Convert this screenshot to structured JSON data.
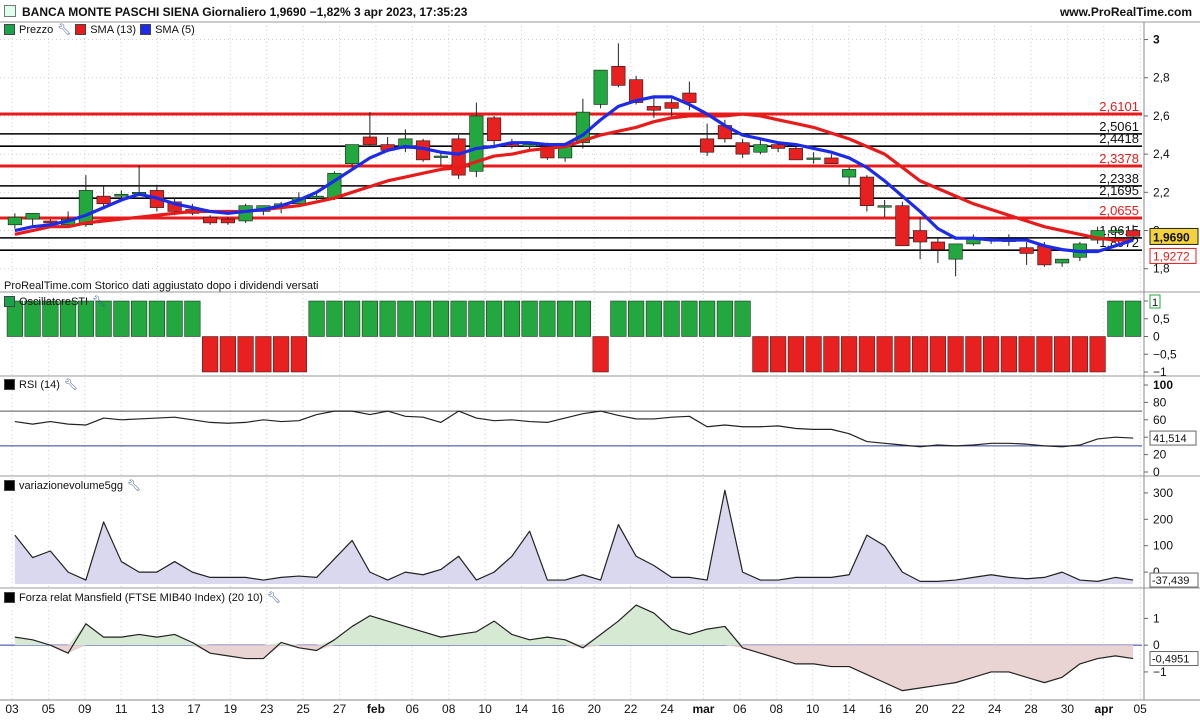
{
  "header": {
    "title": "BANCA MONTE PASCHI SIENA Giornaliero 1,9690 −1,82% 3 apr 2023, 17:35:23",
    "site": "www.ProRealTime.com"
  },
  "panels": {
    "price": {
      "legend": [
        {
          "label": "Prezzo",
          "color": "#19a34a"
        },
        {
          "label": "SMA (13)",
          "color": "#e81b1b"
        },
        {
          "label": "SMA (5)",
          "color": "#1b2be8"
        }
      ],
      "note": "ProRealTime.com Storico dati aggiustato dopo i dividendi versati"
    },
    "sti": {
      "legend": "OscillatoreSTI"
    },
    "rsi": {
      "legend": "RSI (14)"
    },
    "vol": {
      "legend": "variazionevolume5gg"
    },
    "mansfield": {
      "legend": "Forza relat Mansfield (FTSE MIB40 Index) (20 10)"
    }
  },
  "colors": {
    "up": "#22a83f",
    "down": "#e8201f",
    "sma13": "#e81b1b",
    "sma5": "#1b2be8",
    "grid": "#cfcfcf",
    "level_red": "#e81b1b",
    "level_black": "#000000"
  },
  "chart_data": [
    {
      "type": "candlestick",
      "title": "Prezzo",
      "ylim": [
        1.72,
        3.05
      ],
      "y_ticks": [
        "1,8",
        "2",
        "2,2",
        "2,4",
        "2,6",
        "2,8",
        "3"
      ],
      "x_ticks": [
        "03",
        "05",
        "09",
        "11",
        "13",
        "17",
        "19",
        "23",
        "25",
        "27",
        "feb",
        "06",
        "08",
        "10",
        "14",
        "16",
        "20",
        "22",
        "24",
        "mar",
        "06",
        "08",
        "10",
        "14",
        "16",
        "20",
        "22",
        "24",
        "28",
        "30",
        "apr",
        "05"
      ],
      "candles": [
        {
          "o": 2.03,
          "h": 2.09,
          "l": 2.01,
          "c": 2.07
        },
        {
          "o": 2.06,
          "h": 2.09,
          "l": 2.02,
          "c": 2.09
        },
        {
          "o": 2.05,
          "h": 2.06,
          "l": 2.02,
          "c": 2.04
        },
        {
          "o": 2.03,
          "h": 2.1,
          "l": 2.02,
          "c": 2.06
        },
        {
          "o": 2.03,
          "h": 2.29,
          "l": 2.02,
          "c": 2.21
        },
        {
          "o": 2.18,
          "h": 2.23,
          "l": 2.12,
          "c": 2.14
        },
        {
          "o": 2.18,
          "h": 2.21,
          "l": 2.16,
          "c": 2.19
        },
        {
          "o": 2.2,
          "h": 2.34,
          "l": 2.18,
          "c": 2.2
        },
        {
          "o": 2.21,
          "h": 2.24,
          "l": 2.1,
          "c": 2.12
        },
        {
          "o": 2.15,
          "h": 2.17,
          "l": 2.08,
          "c": 2.1
        },
        {
          "o": 2.11,
          "h": 2.14,
          "l": 2.08,
          "c": 2.09
        },
        {
          "o": 2.07,
          "h": 2.08,
          "l": 2.03,
          "c": 2.04
        },
        {
          "o": 2.06,
          "h": 2.07,
          "l": 2.03,
          "c": 2.04
        },
        {
          "o": 2.05,
          "h": 2.14,
          "l": 2.04,
          "c": 2.13
        },
        {
          "o": 2.1,
          "h": 2.13,
          "l": 2.08,
          "c": 2.13
        },
        {
          "o": 2.12,
          "h": 2.15,
          "l": 2.09,
          "c": 2.14
        },
        {
          "o": 2.14,
          "h": 2.2,
          "l": 2.13,
          "c": 2.17
        },
        {
          "o": 2.17,
          "h": 2.2,
          "l": 2.16,
          "c": 2.18
        },
        {
          "o": 2.17,
          "h": 2.31,
          "l": 2.16,
          "c": 2.3
        },
        {
          "o": 2.35,
          "h": 2.45,
          "l": 2.33,
          "c": 2.45
        },
        {
          "o": 2.49,
          "h": 2.62,
          "l": 2.44,
          "c": 2.45
        },
        {
          "o": 2.45,
          "h": 2.49,
          "l": 2.41,
          "c": 2.42
        },
        {
          "o": 2.43,
          "h": 2.53,
          "l": 2.41,
          "c": 2.48
        },
        {
          "o": 2.47,
          "h": 2.48,
          "l": 2.36,
          "c": 2.37
        },
        {
          "o": 2.39,
          "h": 2.41,
          "l": 2.34,
          "c": 2.39
        },
        {
          "o": 2.48,
          "h": 2.5,
          "l": 2.27,
          "c": 2.29
        },
        {
          "o": 2.31,
          "h": 2.67,
          "l": 2.28,
          "c": 2.6
        },
        {
          "o": 2.59,
          "h": 2.6,
          "l": 2.44,
          "c": 2.47
        },
        {
          "o": 2.45,
          "h": 2.48,
          "l": 2.43,
          "c": 2.44
        },
        {
          "o": 2.44,
          "h": 2.46,
          "l": 2.42,
          "c": 2.45
        },
        {
          "o": 2.44,
          "h": 2.46,
          "l": 2.37,
          "c": 2.38
        },
        {
          "o": 2.38,
          "h": 2.46,
          "l": 2.36,
          "c": 2.44
        },
        {
          "o": 2.46,
          "h": 2.69,
          "l": 2.43,
          "c": 2.62
        },
        {
          "o": 2.66,
          "h": 2.82,
          "l": 2.64,
          "c": 2.84
        },
        {
          "o": 2.86,
          "h": 2.98,
          "l": 2.75,
          "c": 2.76
        },
        {
          "o": 2.79,
          "h": 2.81,
          "l": 2.66,
          "c": 2.67
        },
        {
          "o": 2.65,
          "h": 2.7,
          "l": 2.59,
          "c": 2.63
        },
        {
          "o": 2.67,
          "h": 2.69,
          "l": 2.59,
          "c": 2.64
        },
        {
          "o": 2.72,
          "h": 2.78,
          "l": 2.63,
          "c": 2.67
        },
        {
          "o": 2.48,
          "h": 2.56,
          "l": 2.39,
          "c": 2.41
        },
        {
          "o": 2.55,
          "h": 2.58,
          "l": 2.46,
          "c": 2.48
        },
        {
          "o": 2.46,
          "h": 2.48,
          "l": 2.38,
          "c": 2.4
        },
        {
          "o": 2.41,
          "h": 2.48,
          "l": 2.4,
          "c": 2.45
        },
        {
          "o": 2.45,
          "h": 2.46,
          "l": 2.41,
          "c": 2.43
        },
        {
          "o": 2.43,
          "h": 2.44,
          "l": 2.37,
          "c": 2.37
        },
        {
          "o": 2.38,
          "h": 2.41,
          "l": 2.35,
          "c": 2.38
        },
        {
          "o": 2.38,
          "h": 2.4,
          "l": 2.35,
          "c": 2.35
        },
        {
          "o": 2.28,
          "h": 2.33,
          "l": 2.24,
          "c": 2.32
        },
        {
          "o": 2.28,
          "h": 2.29,
          "l": 2.1,
          "c": 2.13
        },
        {
          "o": 2.13,
          "h": 2.16,
          "l": 2.07,
          "c": 2.13
        },
        {
          "o": 2.13,
          "h": 2.15,
          "l": 1.92,
          "c": 1.92
        },
        {
          "o": 2.0,
          "h": 2.07,
          "l": 1.85,
          "c": 1.94
        },
        {
          "o": 1.94,
          "h": 1.96,
          "l": 1.83,
          "c": 1.9
        },
        {
          "o": 1.85,
          "h": 1.92,
          "l": 1.76,
          "c": 1.93
        },
        {
          "o": 1.93,
          "h": 1.98,
          "l": 1.92,
          "c": 1.96
        },
        {
          "o": 1.95,
          "h": 1.96,
          "l": 1.93,
          "c": 1.96
        },
        {
          "o": 1.95,
          "h": 1.98,
          "l": 1.92,
          "c": 1.95
        },
        {
          "o": 1.91,
          "h": 1.94,
          "l": 1.82,
          "c": 1.88
        },
        {
          "o": 1.92,
          "h": 1.94,
          "l": 1.81,
          "c": 1.82
        },
        {
          "o": 1.83,
          "h": 1.85,
          "l": 1.81,
          "c": 1.85
        },
        {
          "o": 1.86,
          "h": 1.94,
          "l": 1.84,
          "c": 1.93
        },
        {
          "o": 1.95,
          "h": 2.02,
          "l": 1.93,
          "c": 2.0
        },
        {
          "o": 1.99,
          "h": 2.02,
          "l": 1.96,
          "c": 2.0
        },
        {
          "o": 2.0,
          "h": 2.03,
          "l": 1.96,
          "c": 1.97
        }
      ],
      "sma13": [
        1.98,
        2.0,
        2.02,
        2.02,
        2.04,
        2.05,
        2.06,
        2.07,
        2.08,
        2.09,
        2.1,
        2.1,
        2.1,
        2.1,
        2.11,
        2.12,
        2.13,
        2.15,
        2.17,
        2.2,
        2.23,
        2.26,
        2.28,
        2.3,
        2.32,
        2.33,
        2.36,
        2.39,
        2.4,
        2.42,
        2.43,
        2.44,
        2.47,
        2.5,
        2.52,
        2.54,
        2.57,
        2.59,
        2.6,
        2.6,
        2.6,
        2.61,
        2.6,
        2.58,
        2.56,
        2.54,
        2.51,
        2.48,
        2.44,
        2.4,
        2.33,
        2.26,
        2.22,
        2.18,
        2.14,
        2.11,
        2.08,
        2.05,
        2.02,
        2.0,
        1.98,
        1.96,
        1.95,
        1.95
      ],
      "sma5": [
        2.0,
        2.02,
        2.03,
        2.05,
        2.08,
        2.12,
        2.16,
        2.19,
        2.17,
        2.14,
        2.12,
        2.1,
        2.09,
        2.1,
        2.11,
        2.13,
        2.16,
        2.2,
        2.26,
        2.32,
        2.38,
        2.42,
        2.44,
        2.43,
        2.41,
        2.4,
        2.43,
        2.44,
        2.46,
        2.46,
        2.45,
        2.45,
        2.5,
        2.58,
        2.65,
        2.68,
        2.7,
        2.7,
        2.66,
        2.61,
        2.55,
        2.5,
        2.48,
        2.46,
        2.45,
        2.43,
        2.41,
        2.38,
        2.33,
        2.26,
        2.18,
        2.1,
        2.01,
        1.96,
        1.96,
        1.95,
        1.95,
        1.95,
        1.92,
        1.9,
        1.89,
        1.89,
        1.92,
        1.95
      ],
      "levels": [
        {
          "value": 2.6101,
          "label": "2,6101",
          "color": "red"
        },
        {
          "value": 2.5061,
          "label": "2,5061",
          "color": "black"
        },
        {
          "value": 2.4418,
          "label": "2,4418",
          "color": "black"
        },
        {
          "value": 2.3378,
          "label": "2,3378",
          "color": "red"
        },
        {
          "value": 2.2338,
          "label": "2,2338",
          "color": "black"
        },
        {
          "value": 2.1695,
          "label": "2,1695",
          "color": "black"
        },
        {
          "value": 2.0655,
          "label": "2,0655",
          "color": "red"
        },
        {
          "value": 1.9615,
          "label": "1,9615",
          "color": "black"
        },
        {
          "value": 1.8972,
          "label": "1,8972",
          "color": "black"
        }
      ],
      "last_price": {
        "value": 1.969,
        "label": "1,9690"
      },
      "last_sma13": {
        "value": 1.9272,
        "label": "1,9272"
      }
    },
    {
      "type": "bar",
      "title": "OscillatoreSTI",
      "ylim": [
        -1,
        1
      ],
      "y_ticks": [
        "1",
        "0,5",
        "0",
        "−0,5",
        "−1"
      ],
      "values": [
        1,
        1,
        1,
        1,
        1,
        1,
        1,
        1,
        1,
        1,
        1,
        -1,
        -1,
        -1,
        -1,
        -1,
        -1,
        1,
        1,
        1,
        1,
        1,
        1,
        1,
        1,
        1,
        1,
        1,
        1,
        1,
        1,
        1,
        1,
        -1,
        1,
        1,
        1,
        1,
        1,
        1,
        1,
        1,
        -1,
        -1,
        -1,
        -1,
        -1,
        -1,
        -1,
        -1,
        -1,
        -1,
        -1,
        -1,
        -1,
        -1,
        -1,
        -1,
        -1,
        -1,
        -1,
        -1,
        1,
        1
      ],
      "last_label": "1"
    },
    {
      "type": "line",
      "title": "RSI (14)",
      "ylim": [
        0,
        100
      ],
      "y_ticks": [
        "100",
        "80",
        "60",
        "40",
        "20",
        "0"
      ],
      "hlines": [
        70,
        30
      ],
      "values": [
        58,
        55,
        58,
        55,
        54,
        62,
        60,
        61,
        62,
        63,
        60,
        57,
        56,
        57,
        60,
        58,
        59,
        66,
        70,
        70,
        66,
        70,
        64,
        63,
        57,
        70,
        62,
        59,
        60,
        58,
        57,
        62,
        67,
        70,
        65,
        61,
        61,
        63,
        64,
        52,
        54,
        52,
        52,
        53,
        50,
        49,
        49,
        44,
        35,
        33,
        31,
        29,
        31,
        30,
        31,
        33,
        33,
        32,
        30,
        29,
        31,
        38,
        40,
        39
      ],
      "last_label": "41,514"
    },
    {
      "type": "area",
      "title": "variazionevolume5gg",
      "ylim": [
        -45,
        330
      ],
      "y_ticks": [
        "300",
        "200",
        "100",
        "0"
      ],
      "values": [
        140,
        55,
        80,
        0,
        -30,
        190,
        40,
        0,
        0,
        40,
        0,
        -20,
        -20,
        -20,
        -30,
        -20,
        -15,
        -20,
        50,
        120,
        0,
        -30,
        0,
        -10,
        10,
        60,
        -30,
        0,
        60,
        155,
        -30,
        -30,
        -10,
        -30,
        180,
        60,
        25,
        -20,
        -20,
        -30,
        310,
        0,
        -30,
        -30,
        -20,
        -20,
        -20,
        -10,
        140,
        100,
        0,
        -35,
        -35,
        -30,
        -20,
        -10,
        -20,
        -25,
        -20,
        0,
        -30,
        -35,
        -20,
        -30
      ],
      "last_label": "-37,439"
    },
    {
      "type": "area",
      "title": "Forza relat Mansfield (FTSE MIB40 Index) (20 10)",
      "ylim": [
        -1.9,
        1.8
      ],
      "y_ticks": [
        "1",
        "0",
        "−1"
      ],
      "values": [
        0.3,
        0.2,
        0,
        -0.3,
        0.8,
        0.3,
        0.3,
        0.4,
        0.3,
        0.4,
        0.1,
        -0.3,
        -0.4,
        -0.5,
        -0.5,
        0.1,
        -0.1,
        -0.2,
        0.2,
        0.7,
        1.1,
        0.9,
        0.7,
        0.5,
        0.3,
        0.4,
        0.5,
        0.9,
        0.4,
        0.2,
        0.3,
        0.2,
        -0.1,
        0.4,
        0.9,
        1.5,
        1.2,
        0.6,
        0.4,
        0.6,
        0.7,
        -0.1,
        -0.3,
        -0.5,
        -0.7,
        -0.7,
        -0.8,
        -0.8,
        -1.1,
        -1.4,
        -1.7,
        -1.6,
        -1.5,
        -1.4,
        -1.2,
        -1.0,
        -1.0,
        -1.2,
        -1.4,
        -1.2,
        -0.7,
        -0.5,
        -0.4,
        -0.5
      ],
      "last_label": "-0,4951"
    }
  ]
}
